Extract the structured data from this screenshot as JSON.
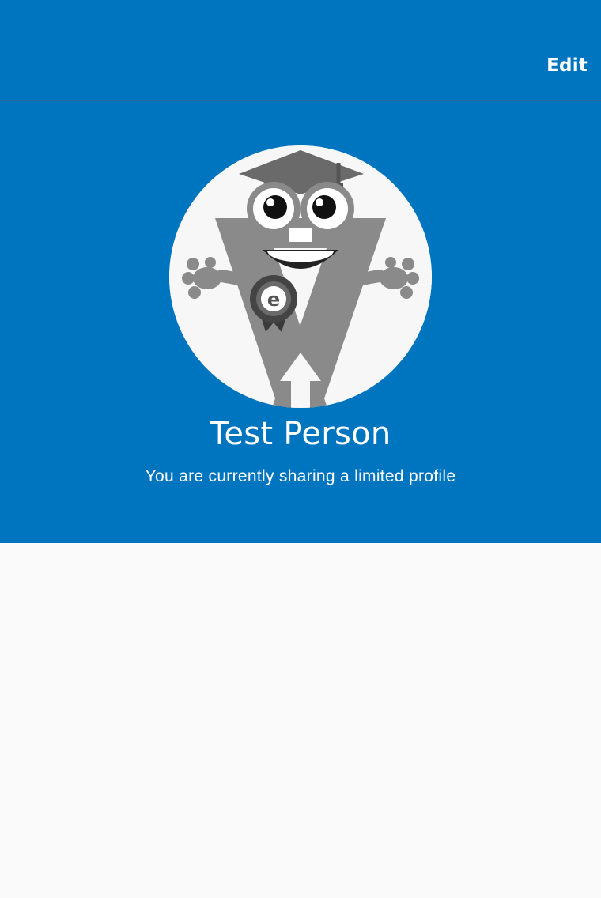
{
  "nav_bar": {
    "edit_label": "Edit"
  },
  "profile": {
    "name": "Test Person",
    "status": "You are currently sharing a limited profile",
    "avatar_icon": "mascot-avatar-icon",
    "badge_letter": "e"
  },
  "colors": {
    "header_blue": "#0075bf",
    "background": "#fafafa",
    "text_white": "#ffffff"
  }
}
